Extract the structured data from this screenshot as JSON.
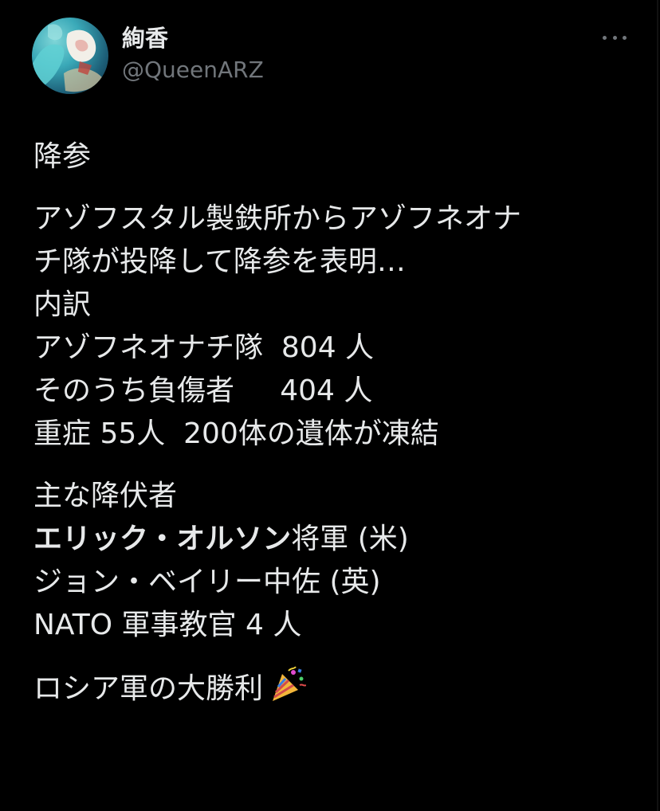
{
  "post": {
    "author": {
      "display_name": "絢香",
      "handle": "@QueenARZ"
    },
    "text": {
      "l1": "降参",
      "l2": "アゾフスタル製鉄所からアゾフネオナ",
      "l3": "チ隊が投降して降参を表明…",
      "l4": "内訳",
      "l5": "アゾフネオナチ隊  804 人",
      "l6": "そのうち負傷者     404 人",
      "l7": "重症 55人  200体の遺体が凍結",
      "l8": "主な降伏者",
      "l9_bold": "エリック・オルソン",
      "l9_rest": "将軍 (米)",
      "l10": "ジョン・ベイリー中佐 (英)",
      "l11": "NATO 軍事教官 4 人",
      "l12": "ロシア軍の大勝利"
    },
    "emoji": "party-popper-icon"
  },
  "colors": {
    "background": "#000000",
    "text": "#e7e9ea",
    "secondary": "#71767b"
  }
}
